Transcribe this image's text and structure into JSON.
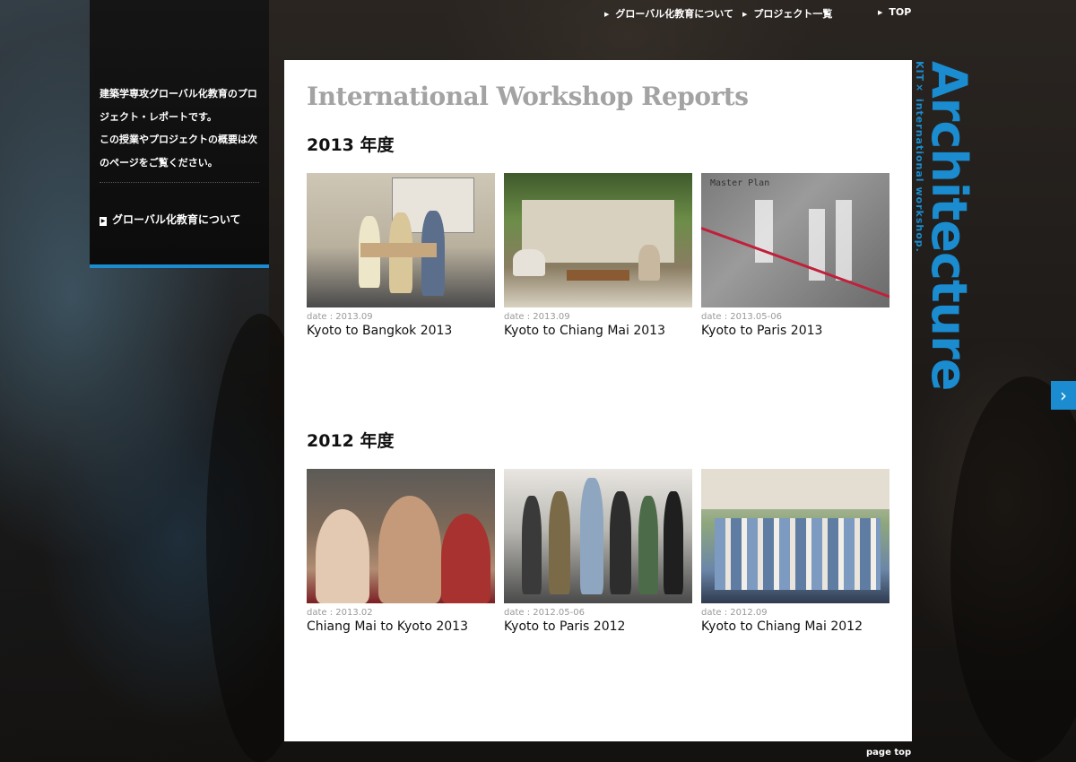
{
  "nav": {
    "items": [
      {
        "label": "グローバル化教育について"
      },
      {
        "label": "プロジェクト一覧"
      },
      {
        "label": "TOP"
      }
    ]
  },
  "sidebar": {
    "intro_line1": "建築学専攻グローバル化教育のプロ",
    "intro_line2": "ジェクト・レポートです。",
    "intro_line3": "この授業やプロジェクトの概要は次",
    "intro_line4": "のページをご覧ください。",
    "link_label": "グローバル化教育について"
  },
  "main": {
    "title": "International Workshop Reports",
    "sections": [
      {
        "heading": "2013 年度",
        "cards": [
          {
            "date": "date : 2013.09",
            "title": "Kyoto to Bangkok 2013"
          },
          {
            "date": "date : 2013.09",
            "title": "Kyoto to Chiang Mai 2013"
          },
          {
            "date": "date : 2013.05-06",
            "title": "Kyoto to Paris 2013",
            "image_caption": "Master Plan"
          }
        ]
      },
      {
        "heading": "2012 年度",
        "cards": [
          {
            "date": "date : 2013.02",
            "title": "Chiang Mai to Kyoto 2013"
          },
          {
            "date": "date : 2012.05-06",
            "title": "Kyoto to Paris 2012"
          },
          {
            "date": "date : 2012.09",
            "title": "Kyoto to Chiang Mai 2012"
          }
        ]
      }
    ]
  },
  "brand": {
    "title": "Architecture",
    "subtitle": "KIT× international workshop."
  },
  "footer": {
    "page_top": "page top"
  },
  "colors": {
    "accent": "#1a8ccf",
    "title_gray": "#a3a3a3"
  },
  "icons": {
    "nav_arrow": "triangle-right-icon",
    "next": "chevron-right-icon"
  }
}
